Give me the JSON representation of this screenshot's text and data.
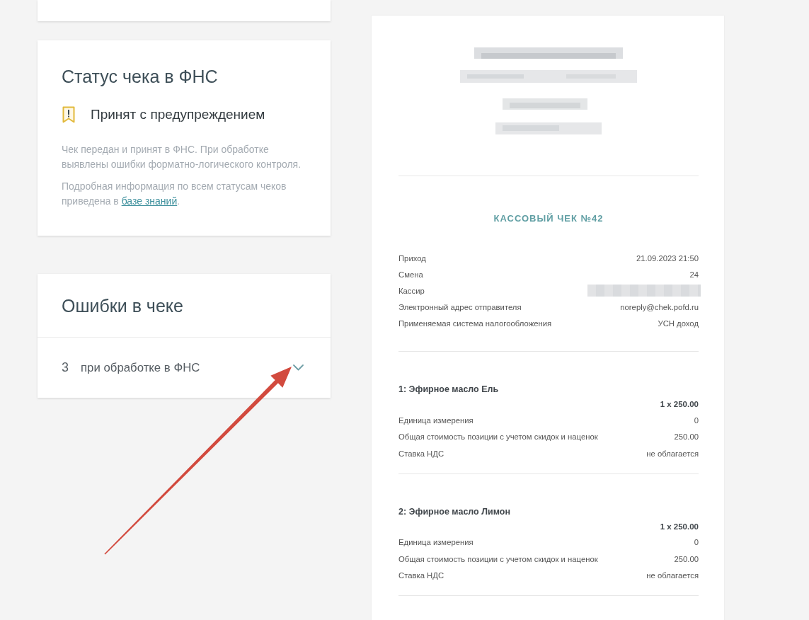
{
  "status_card": {
    "title": "Статус чека в ФНС",
    "status": {
      "kind": "warning",
      "label": "Принят с предупреждением"
    },
    "description": "Чек передан и принят в ФНС. При обработке выявлены ошибки форматно-логического контроля.",
    "info": {
      "text": "Подробная информация по всем статусам чеков приведена в",
      "link": "базе знаний",
      "after": "."
    }
  },
  "errors_card": {
    "title": "Ошибки в чеке",
    "groups": [
      {
        "count": "3",
        "label": "при обработке в ФНС",
        "expanded": false
      }
    ]
  },
  "receipt": {
    "title": "КАССОВЫЙ ЧЕК №42",
    "fields": [
      {
        "label": "Приход",
        "value": "21.09.2023 21:50",
        "redacted": false
      },
      {
        "label": "Смена",
        "value": "24",
        "redacted": false
      },
      {
        "label": "Кассир",
        "redacted": true
      },
      {
        "label": "Электронный адрес отправителя",
        "value": "noreply@chek.pofd.ru",
        "redacted": false
      },
      {
        "label": "Применяемая система налогообложения",
        "value": "УСН доход",
        "redacted": false
      }
    ],
    "items": [
      {
        "title": "1: Эфирное масло Ель",
        "quantity_price": "1 x 250.00",
        "fields": [
          {
            "label": "Единица измерения",
            "value": "0"
          },
          {
            "label": "Общая стоимость позиции с учетом скидок и наценок",
            "value": "250.00"
          },
          {
            "label": "Ставка НДС",
            "value": "не облагается"
          }
        ]
      },
      {
        "title": "2: Эфирное масло Лимон",
        "quantity_price": "1 x 250.00",
        "fields": [
          {
            "label": "Единица измерения",
            "value": "0"
          },
          {
            "label": "Общая стоимость позиции с учетом скидок и наценок",
            "value": "250.00"
          },
          {
            "label": "Ставка НДС",
            "value": "не облагается"
          }
        ]
      }
    ]
  }
}
